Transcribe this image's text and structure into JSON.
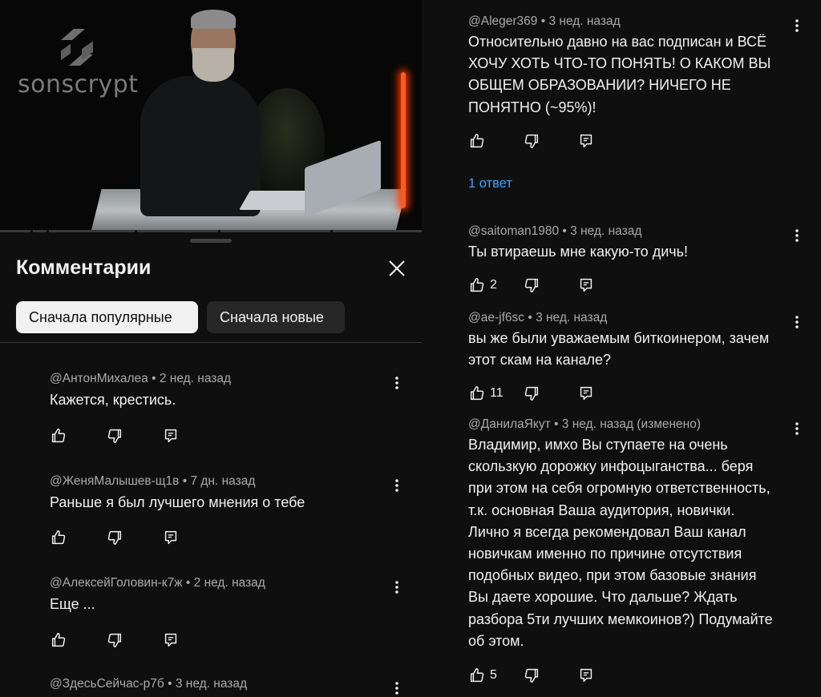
{
  "video": {
    "logo_text": "sonscrypt",
    "logo_icon": "sunscrypt-logo-icon",
    "progress_segments": 6
  },
  "panel": {
    "title": "Комментарии",
    "close_icon": "close-icon",
    "sort_options": [
      {
        "label": "Сначала популярные",
        "selected": true
      },
      {
        "label": "Сначала новые",
        "selected": false
      }
    ]
  },
  "left_comments": [
    {
      "author": "@АнтонМихалеа",
      "time": "2 нед. назад",
      "text": "Кажется, крестись.",
      "likes": ""
    },
    {
      "author": "@ЖеняМалышев-щ1в",
      "time": "7 дн. назад",
      "text": "Раньше я был лучшего мнения о тебе",
      "likes": ""
    },
    {
      "author": "@АлексейГоловин-к7ж",
      "time": "2 нед. назад",
      "text": "Еще ...",
      "likes": ""
    },
    {
      "author": "@ЗдесьСейчас-р7б",
      "time": "3 нед. назад",
      "text": "",
      "likes": ""
    }
  ],
  "right_comments": [
    {
      "author": "@Aleger369",
      "time": "3 нед. назад",
      "text_lines": [
        "Относительно давно на вас подписан и ВСЁ",
        "ХОЧУ ХОТЬ ЧТО-ТО ПОНЯТЬ! О КАКОМ ВЫ",
        "ОБЩЕМ ОБРАЗОВАНИИ? НИЧЕГО НЕ",
        "ПОНЯТНО (~95%)!"
      ],
      "likes": "",
      "replies": "1 ответ"
    },
    {
      "author": "@saitoman1980",
      "time": "3 нед. назад",
      "text_lines": [
        "Ты втираешь мне какую-то дичь!"
      ],
      "likes": "2"
    },
    {
      "author": "@ae-jf6sc",
      "time": "3 нед. назад",
      "text_lines": [
        "вы же были уважаемым биткоинером, зачем",
        "этот скам на канале?"
      ],
      "likes": "11"
    },
    {
      "author": "@ДанилаЯкут",
      "time": "3 нед. назад (изменено)",
      "text_lines": [
        "Владимир, имхо Вы ступаете на очень",
        "скользкую дорожку инфоцыганства... беря",
        "при этом на себя огромную ответственность,",
        "т.к. основная Ваша аудитория, новички.",
        "Лично я всегда рекомендовал Ваш канал",
        "новичкам именно по причине отсутствия",
        "подобных видео, при этом базовые знания",
        "Вы даете хорошие. Что дальше? Ждать",
        "разбора 5ти лучших мемкоинов?) Подумайте",
        "об этом."
      ],
      "likes": "5"
    }
  ],
  "icons": {
    "like": "thumbs-up-icon",
    "dislike": "thumbs-down-icon",
    "reply": "reply-icon",
    "more": "more-vert-icon"
  },
  "colors": {
    "background": "#0f0f0f",
    "text": "#f1f1f1",
    "meta": "#aaaaaa",
    "link": "#3ea6ff",
    "chip_active_bg": "#f1f1f1",
    "chip_inactive_bg": "#272727"
  }
}
